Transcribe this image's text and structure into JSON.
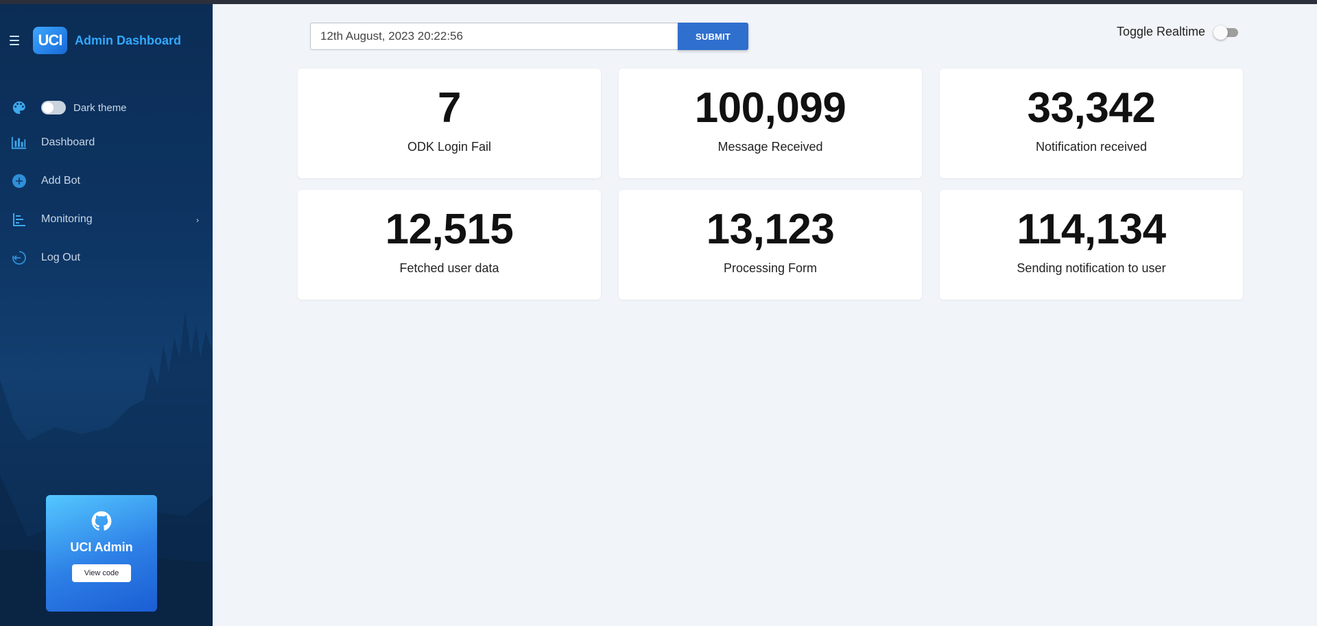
{
  "brand": {
    "logo_text": "UCI",
    "title": "Admin Dashboard"
  },
  "sidebar": {
    "theme_toggle": {
      "label": "Dark theme",
      "on": false
    },
    "items": [
      {
        "label": "Dashboard",
        "icon": "bar-chart-icon"
      },
      {
        "label": "Add Bot",
        "icon": "add-circle-icon"
      },
      {
        "label": "Monitoring",
        "icon": "list-chart-icon",
        "has_submenu": true
      },
      {
        "label": "Log Out",
        "icon": "logout-icon"
      }
    ],
    "github_card": {
      "icon": "github-icon",
      "title": "UCI Admin",
      "button_label": "View code"
    }
  },
  "header": {
    "date_value": "12th August, 2023 20:22:56",
    "submit_label": "SUBMIT",
    "realtime_label": "Toggle Realtime",
    "realtime_on": false
  },
  "stats": [
    {
      "value": "7",
      "label": "ODK Login Fail"
    },
    {
      "value": "100,099",
      "label": "Message Received"
    },
    {
      "value": "33,342",
      "label": "Notification received"
    },
    {
      "value": "12,515",
      "label": "Fetched user data"
    },
    {
      "value": "13,123",
      "label": "Processing Form"
    },
    {
      "value": "114,134",
      "label": "Sending notification to user"
    }
  ],
  "colors": {
    "accent": "#2f6fce",
    "brand_title": "#33a8ff",
    "sidebar_bg": "#0d3462",
    "page_bg": "#f1f4f8"
  }
}
